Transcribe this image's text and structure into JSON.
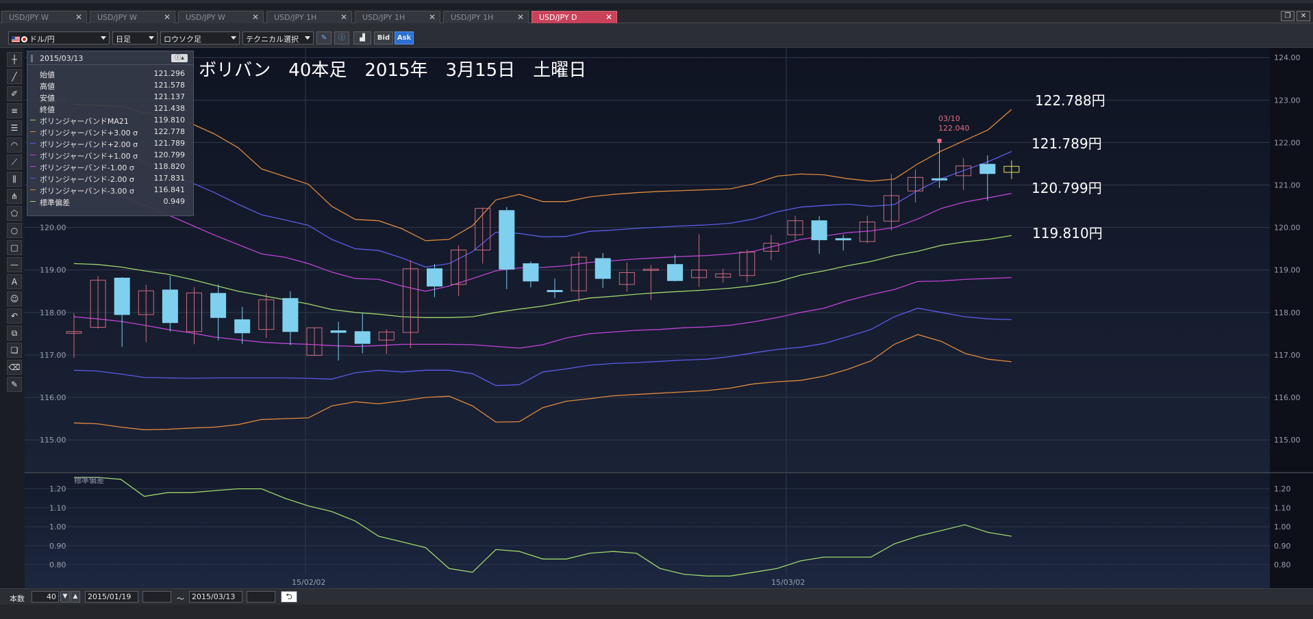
{
  "tabs": [
    {
      "label": "USD/JPY W",
      "active": false
    },
    {
      "label": "USD/JPY W",
      "active": false
    },
    {
      "label": "USD/JPY W",
      "active": false
    },
    {
      "label": "USD/JPY 1H",
      "active": false
    },
    {
      "label": "USD/JPY 1H",
      "active": false
    },
    {
      "label": "USD/JPY 1H",
      "active": false
    },
    {
      "label": "USD/JPY D",
      "active": true
    }
  ],
  "toolbar": {
    "currency": "ドル/円",
    "period": "日足",
    "chart_type": "ロウソク足",
    "technical": "テクニカル選択",
    "bid": "Bid",
    "ask": "Ask"
  },
  "info_panel": {
    "date": "2015/03/13",
    "rows": [
      {
        "label": "始値",
        "value": "121.296",
        "color": ""
      },
      {
        "label": "高値",
        "value": "121.578",
        "color": ""
      },
      {
        "label": "安値",
        "value": "121.137",
        "color": ""
      },
      {
        "label": "終値",
        "value": "121.438",
        "color": ""
      },
      {
        "label": "ボリンジャーバンドMA21",
        "value": "119.810",
        "color": "#9fd66b"
      },
      {
        "label": "ボリンジャーバンド+3.00 σ",
        "value": "122.778",
        "color": "#e08a3c"
      },
      {
        "label": "ボリンジャーバンド+2.00 σ",
        "value": "121.789",
        "color": "#5a5ce8"
      },
      {
        "label": "ボリンジャーバンド+1.00 σ",
        "value": "120.799",
        "color": "#c044d8"
      },
      {
        "label": "ボリンジャーバンド-1.00 σ",
        "value": "118.820",
        "color": "#c044d8"
      },
      {
        "label": "ボリンジャーバンド-2.00 σ",
        "value": "117.831",
        "color": "#5a5ce8"
      },
      {
        "label": "ボリンジャーバンド-3.00 σ",
        "value": "116.841",
        "color": "#e08a3c"
      },
      {
        "label": "標準偏差",
        "value": "0.949",
        "color": "#9fd66b"
      }
    ]
  },
  "annotation": {
    "title": "ボリバン　40本足　2015年　3月15日　土曜日",
    "labels": [
      "122.788円",
      "121.789円",
      "120.799円",
      "119.810円"
    ]
  },
  "high_marker": {
    "date": "03/10",
    "value": "122.040"
  },
  "sub_chart_title": "標準偏差",
  "x_labels": [
    "15/02/02",
    "15/03/02"
  ],
  "bottom": {
    "count_label": "本数",
    "count": "40",
    "start_date": "2015/01/19",
    "tilde": "〜",
    "end_date": "2015/03/13"
  },
  "chart_data": [
    {
      "type": "candlestick",
      "title": "",
      "ylim": [
        114.6,
        124.1
      ],
      "yticks": [
        "124.00",
        "123.00",
        "122.00",
        "121.00",
        "120.00",
        "119.00",
        "118.00",
        "117.00",
        "116.00",
        "115.00"
      ],
      "ytick_values": [
        124,
        123,
        122,
        121,
        120,
        119,
        118,
        117,
        116,
        115
      ],
      "colors": {
        "up": "#d16b7f",
        "down": "#7fd0ee",
        "last": "#e8e05a"
      },
      "candles": [
        {
          "o": 117.51,
          "h": 117.98,
          "l": 116.93,
          "c": 117.55
        },
        {
          "o": 117.65,
          "h": 118.86,
          "l": 117.62,
          "c": 118.76
        },
        {
          "o": 118.81,
          "h": 118.83,
          "l": 117.19,
          "c": 117.95
        },
        {
          "o": 117.95,
          "h": 118.65,
          "l": 117.3,
          "c": 118.51
        },
        {
          "o": 118.53,
          "h": 118.86,
          "l": 117.55,
          "c": 117.76
        },
        {
          "o": 117.55,
          "h": 118.6,
          "l": 117.25,
          "c": 118.46
        },
        {
          "o": 118.45,
          "h": 118.66,
          "l": 117.34,
          "c": 117.88
        },
        {
          "o": 117.83,
          "h": 118.13,
          "l": 117.26,
          "c": 117.52
        },
        {
          "o": 117.6,
          "h": 118.45,
          "l": 117.4,
          "c": 118.3
        },
        {
          "o": 118.33,
          "h": 118.5,
          "l": 117.23,
          "c": 117.55
        },
        {
          "o": 116.99,
          "h": 117.65,
          "l": 116.99,
          "c": 117.64
        },
        {
          "o": 117.57,
          "h": 117.78,
          "l": 116.87,
          "c": 117.53
        },
        {
          "o": 117.55,
          "h": 117.98,
          "l": 117.04,
          "c": 117.27
        },
        {
          "o": 117.35,
          "h": 117.6,
          "l": 117.02,
          "c": 117.54
        },
        {
          "o": 117.53,
          "h": 119.23,
          "l": 117.16,
          "c": 119.03
        },
        {
          "o": 119.03,
          "h": 119.14,
          "l": 118.36,
          "c": 118.62
        },
        {
          "o": 118.66,
          "h": 119.58,
          "l": 118.39,
          "c": 119.47
        },
        {
          "o": 119.47,
          "h": 120.47,
          "l": 119.15,
          "c": 120.45
        },
        {
          "o": 120.4,
          "h": 120.48,
          "l": 118.55,
          "c": 119.02
        },
        {
          "o": 119.15,
          "h": 119.2,
          "l": 118.59,
          "c": 118.74
        },
        {
          "o": 118.52,
          "h": 118.8,
          "l": 118.34,
          "c": 118.5
        },
        {
          "o": 118.51,
          "h": 119.43,
          "l": 118.24,
          "c": 119.3
        },
        {
          "o": 119.27,
          "h": 119.4,
          "l": 118.58,
          "c": 118.8
        },
        {
          "o": 118.66,
          "h": 119.18,
          "l": 118.49,
          "c": 118.94
        },
        {
          "o": 119.02,
          "h": 119.12,
          "l": 118.3,
          "c": 119.02
        },
        {
          "o": 119.13,
          "h": 119.36,
          "l": 118.73,
          "c": 118.75
        },
        {
          "o": 118.82,
          "h": 119.84,
          "l": 118.6,
          "c": 119.0
        },
        {
          "o": 118.83,
          "h": 119.03,
          "l": 118.7,
          "c": 118.91
        },
        {
          "o": 118.87,
          "h": 119.48,
          "l": 118.71,
          "c": 119.42
        },
        {
          "o": 119.44,
          "h": 119.83,
          "l": 119.23,
          "c": 119.63
        },
        {
          "o": 119.83,
          "h": 120.28,
          "l": 119.69,
          "c": 120.16
        },
        {
          "o": 120.16,
          "h": 120.27,
          "l": 119.38,
          "c": 119.71
        },
        {
          "o": 119.74,
          "h": 119.83,
          "l": 119.46,
          "c": 119.73
        },
        {
          "o": 119.67,
          "h": 120.28,
          "l": 119.63,
          "c": 120.13
        },
        {
          "o": 120.15,
          "h": 121.26,
          "l": 119.93,
          "c": 120.75
        },
        {
          "o": 120.86,
          "h": 121.37,
          "l": 120.59,
          "c": 121.18
        },
        {
          "o": 121.15,
          "h": 122.04,
          "l": 120.93,
          "c": 121.14
        },
        {
          "o": 121.22,
          "h": 121.63,
          "l": 120.88,
          "c": 121.45
        },
        {
          "o": 121.49,
          "h": 121.7,
          "l": 120.63,
          "c": 121.27
        },
        {
          "o": 121.3,
          "h": 121.58,
          "l": 121.14,
          "c": 121.44
        }
      ],
      "bands": [
        {
          "name": "+3σ",
          "color": "#e08a3c",
          "values": [
            122.9,
            122.88,
            122.85,
            122.7,
            122.62,
            122.45,
            122.2,
            121.88,
            121.38,
            121.2,
            121.02,
            120.5,
            120.19,
            120.16,
            119.97,
            119.69,
            119.72,
            120.04,
            120.65,
            120.78,
            120.61,
            120.61,
            120.72,
            120.78,
            120.82,
            120.85,
            120.87,
            120.89,
            120.91,
            121.03,
            121.21,
            121.26,
            121.24,
            121.15,
            121.09,
            121.14,
            121.5,
            121.8,
            122.05,
            122.3,
            122.78
          ]
        },
        {
          "name": "+2σ",
          "color": "#5a5ce8",
          "values": [
            121.9,
            121.88,
            121.82,
            121.55,
            121.3,
            121.06,
            120.82,
            120.55,
            120.3,
            120.18,
            120.05,
            119.72,
            119.5,
            119.46,
            119.28,
            119.07,
            119.15,
            119.43,
            119.89,
            119.86,
            119.78,
            119.79,
            119.91,
            119.94,
            119.98,
            120.01,
            120.04,
            120.06,
            120.1,
            120.2,
            120.37,
            120.48,
            120.52,
            120.55,
            120.5,
            120.54,
            120.87,
            121.15,
            121.35,
            121.55,
            121.79
          ]
        },
        {
          "name": "+1σ",
          "color": "#c044d8",
          "values": [
            120.9,
            120.85,
            120.78,
            120.52,
            120.3,
            120.06,
            119.82,
            119.6,
            119.38,
            119.3,
            119.15,
            118.95,
            118.8,
            118.78,
            118.62,
            118.5,
            118.62,
            118.8,
            118.98,
            119.05,
            119.06,
            119.1,
            119.18,
            119.22,
            119.26,
            119.29,
            119.32,
            119.34,
            119.38,
            119.44,
            119.58,
            119.72,
            119.8,
            119.88,
            119.92,
            120.0,
            120.2,
            120.45,
            120.6,
            120.7,
            120.8
          ]
        },
        {
          "name": "MA21",
          "color": "#9fd66b",
          "values": [
            119.15,
            119.13,
            119.07,
            118.98,
            118.9,
            118.78,
            118.64,
            118.5,
            118.4,
            118.3,
            118.2,
            118.07,
            118.0,
            117.96,
            117.9,
            117.88,
            117.88,
            117.9,
            118.0,
            118.08,
            118.15,
            118.25,
            118.34,
            118.38,
            118.43,
            118.47,
            118.5,
            118.53,
            118.57,
            118.63,
            118.72,
            118.88,
            118.98,
            119.1,
            119.2,
            119.34,
            119.44,
            119.58,
            119.66,
            119.72,
            119.81
          ]
        },
        {
          "name": "-1σ",
          "color": "#c044d8",
          "values": [
            117.9,
            117.85,
            117.79,
            117.7,
            117.6,
            117.52,
            117.42,
            117.36,
            117.3,
            117.27,
            117.25,
            117.22,
            117.2,
            117.22,
            117.25,
            117.25,
            117.25,
            117.24,
            117.2,
            117.16,
            117.24,
            117.4,
            117.5,
            117.54,
            117.58,
            117.6,
            117.64,
            117.66,
            117.7,
            117.78,
            117.88,
            118.0,
            118.1,
            118.28,
            118.42,
            118.54,
            118.73,
            118.74,
            118.78,
            118.8,
            118.82
          ]
        },
        {
          "name": "-2σ",
          "color": "#5a5ce8",
          "values": [
            116.64,
            116.62,
            116.55,
            116.47,
            116.46,
            116.45,
            116.46,
            116.46,
            116.46,
            116.46,
            116.45,
            116.43,
            116.58,
            116.64,
            116.6,
            116.64,
            116.64,
            116.56,
            116.28,
            116.3,
            116.6,
            116.67,
            116.76,
            116.8,
            116.82,
            116.85,
            116.88,
            116.9,
            116.96,
            117.05,
            117.13,
            117.18,
            117.27,
            117.43,
            117.6,
            117.9,
            118.1,
            118.0,
            117.9,
            117.85,
            117.83
          ]
        },
        {
          "name": "-3σ",
          "color": "#e08a3c",
          "values": [
            115.4,
            115.38,
            115.3,
            115.24,
            115.25,
            115.28,
            115.3,
            115.36,
            115.48,
            115.5,
            115.52,
            115.8,
            115.9,
            115.85,
            115.92,
            116.0,
            116.03,
            115.8,
            115.42,
            115.43,
            115.76,
            115.91,
            115.97,
            116.04,
            116.07,
            116.1,
            116.13,
            116.16,
            116.22,
            116.32,
            116.37,
            116.4,
            116.5,
            116.66,
            116.86,
            117.25,
            117.48,
            117.32,
            117.04,
            116.9,
            116.84
          ]
        }
      ]
    },
    {
      "type": "line",
      "title": "標準偏差",
      "ylim": [
        0.73,
        1.26
      ],
      "yticks": [
        "1.20",
        "1.10",
        "1.00",
        "0.90",
        "0.80"
      ],
      "ytick_values": [
        1.2,
        1.1,
        1.0,
        0.9,
        0.8
      ],
      "series": [
        {
          "name": "標準偏差",
          "color": "#9fd66b",
          "values": [
            1.26,
            1.26,
            1.25,
            1.16,
            1.18,
            1.18,
            1.19,
            1.2,
            1.2,
            1.15,
            1.11,
            1.08,
            1.03,
            0.95,
            0.92,
            0.89,
            0.78,
            0.76,
            0.88,
            0.87,
            0.83,
            0.83,
            0.86,
            0.87,
            0.86,
            0.78,
            0.75,
            0.74,
            0.74,
            0.76,
            0.78,
            0.82,
            0.84,
            0.84,
            0.84,
            0.91,
            0.95,
            0.98,
            1.01,
            0.97,
            0.95
          ]
        }
      ]
    }
  ]
}
